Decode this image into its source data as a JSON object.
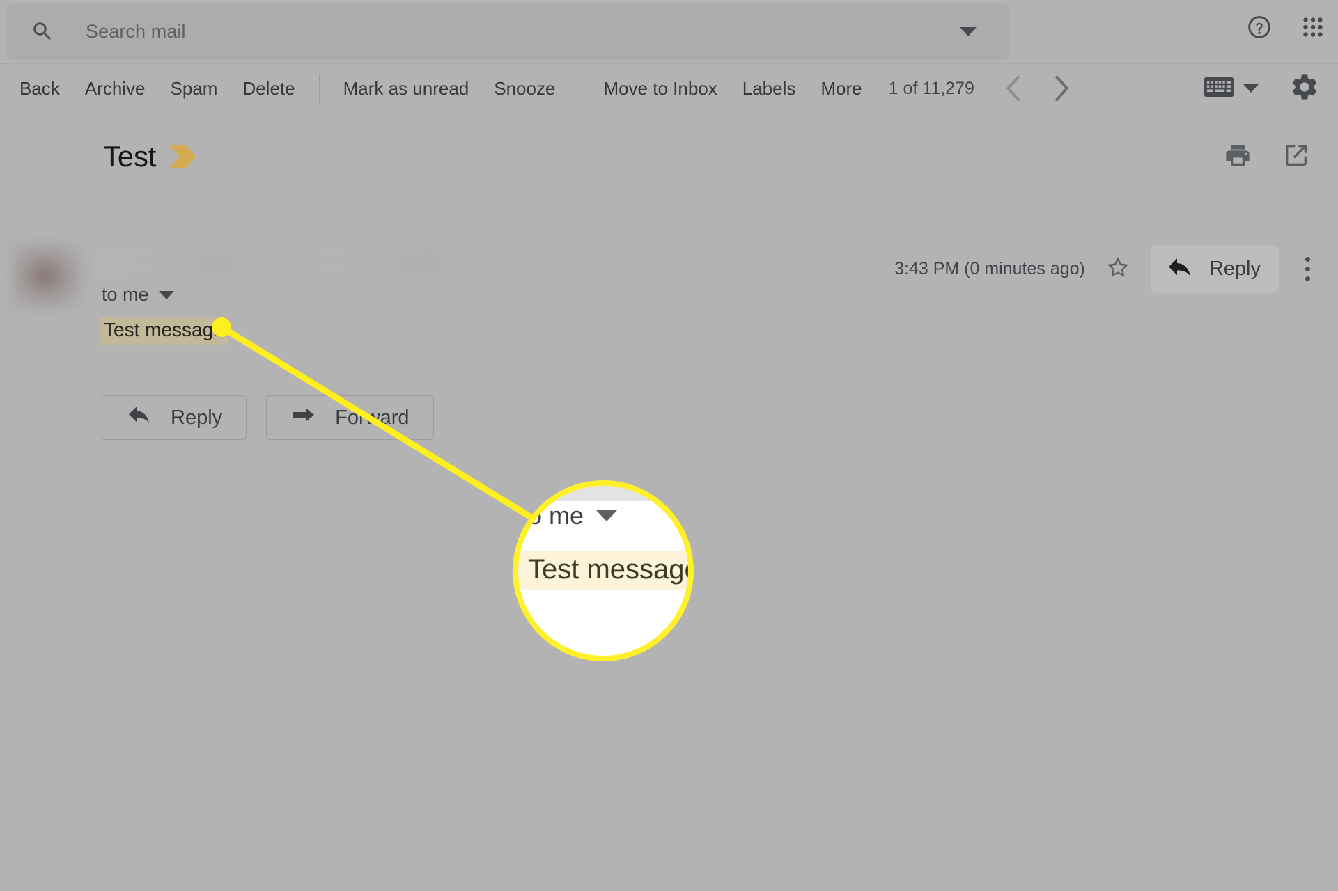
{
  "header": {
    "search": {
      "placeholder": "Search mail",
      "value": "",
      "icon": "search-icon",
      "options_icon": "chevron-down-icon"
    },
    "help_icon": "help-circle-icon",
    "apps_icon": "google-apps-grid-icon"
  },
  "toolbar": {
    "group_1": [
      {
        "label": "Back",
        "name": "back"
      },
      {
        "label": "Archive",
        "name": "archive"
      },
      {
        "label": "Spam",
        "name": "spam"
      },
      {
        "label": "Delete",
        "name": "delete"
      }
    ],
    "group_2": [
      {
        "label": "Mark as unread",
        "name": "mark-as-unread"
      },
      {
        "label": "Snooze",
        "name": "snooze"
      }
    ],
    "group_3": [
      {
        "label": "Move to Inbox",
        "name": "move-to-inbox"
      },
      {
        "label": "Labels",
        "name": "labels"
      },
      {
        "label": "More",
        "name": "more"
      }
    ],
    "count": "1 of 11,279",
    "prev_icon": "chevron-left-icon",
    "next_icon": "chevron-right-icon",
    "keyboard_icon": "keyboard-icon",
    "keyboard_arrow_icon": "chevron-down-icon",
    "settings_icon": "gear-icon"
  },
  "subject": {
    "title": "Test",
    "label_icon": "inbox-label-chevron-icon",
    "label_color": "#d4ab53",
    "print_icon": "printer-icon",
    "popout_icon": "open-in-new-window-icon"
  },
  "message": {
    "avatar": "avatar",
    "sender": "",
    "recipient": "to me",
    "recipient_arrow_icon": "chevron-down-icon",
    "timestamp": "3:43 PM (0 minutes ago)",
    "star_icon": "star-outline-icon",
    "reply_label": "Reply",
    "reply_icon": "reply-arrow-icon",
    "more_icon": "more-vertical-icon",
    "body": "Test message"
  },
  "actions": [
    {
      "label": "Reply",
      "name": "reply",
      "icon": "reply-arrow-icon"
    },
    {
      "label": "Forward",
      "name": "forward",
      "icon": "forward-arrow-icon"
    }
  ],
  "annotation": {
    "accent_color": "#ffef1e",
    "magnifier": {
      "recipient": "o me",
      "recipient_arrow_icon": "chevron-down-icon",
      "body": "Test message",
      "highlight_color": "#fdf3d8"
    }
  }
}
